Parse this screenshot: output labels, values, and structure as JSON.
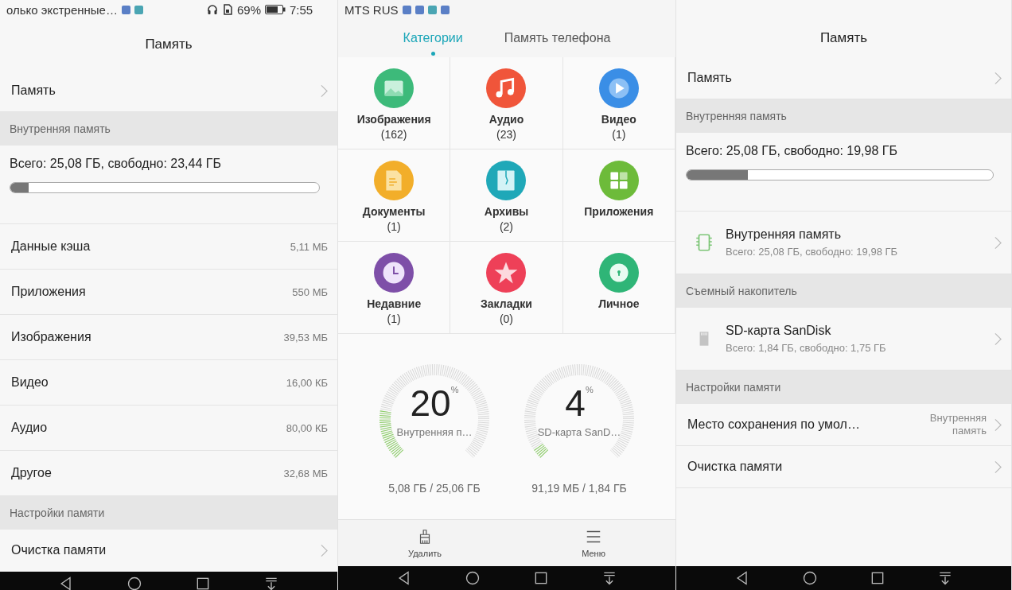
{
  "left": {
    "status_bar": {
      "notice": "олько экстренные…",
      "battery": "69%",
      "time": "7:55"
    },
    "title": "Память",
    "items": [
      {
        "kind": "link",
        "label": "Память"
      },
      {
        "kind": "header",
        "label": "Внутренняя память"
      },
      {
        "kind": "usage",
        "label": "Всего: 25,08 ГБ, свободно: 23,44 ГБ",
        "level": 0.06
      },
      {
        "kind": "value",
        "label": "Данные кэша",
        "value": "5,11 МБ"
      },
      {
        "kind": "value",
        "label": "Приложения",
        "value": "550 МБ"
      },
      {
        "kind": "value",
        "label": "Изображения",
        "value": "39,53 МБ"
      },
      {
        "kind": "value",
        "label": "Видео",
        "value": "16,00 КБ"
      },
      {
        "kind": "value",
        "label": "Аудио",
        "value": "80,00 КБ"
      },
      {
        "kind": "value",
        "label": "Другое",
        "value": "32,68 МБ"
      },
      {
        "kind": "header",
        "label": "Настройки памяти"
      },
      {
        "kind": "link",
        "label": "Очистка памяти"
      }
    ]
  },
  "middle": {
    "status_bar": {
      "carrier": "MTS RUS"
    },
    "tabs": [
      {
        "label": "Категории",
        "selected": true
      },
      {
        "label": "Память телефона",
        "selected": false
      }
    ],
    "categories": [
      {
        "label": "Изображения",
        "count": "(162)",
        "color": "#3dba7a"
      },
      {
        "label": "Аудио",
        "count": "(23)",
        "color": "#f0553a"
      },
      {
        "label": "Видео",
        "count": "(1)",
        "color": "#3a8ee6"
      },
      {
        "label": "Документы",
        "count": "(1)",
        "color": "#f2ae2a"
      },
      {
        "label": "Архивы",
        "count": "(2)",
        "color": "#1fa8b8"
      },
      {
        "label": "Приложения",
        "color": "#6dbb3a"
      },
      {
        "label": "Недавние",
        "count": "(1)",
        "color": "#7e4fa8"
      },
      {
        "label": "Закладки",
        "count": "(0)",
        "color": "#ee4058"
      },
      {
        "label": "Личное",
        "color": "#2fb577"
      }
    ],
    "gauges": [
      {
        "percent": "20",
        "unit": "%",
        "name": "Внутренняя п…",
        "usage": "5,08 ГБ / 25,06 ГБ"
      },
      {
        "percent": "4",
        "unit": "%",
        "name": "SD-карта SanD…",
        "usage": "91,19 МБ / 1,84 ГБ"
      }
    ],
    "toolbar": [
      {
        "label": "Удалить"
      },
      {
        "label": "Меню"
      }
    ]
  },
  "right": {
    "title": "Память",
    "items": [
      {
        "kind": "link",
        "label": "Память"
      },
      {
        "kind": "header",
        "label": "Внутренняя память"
      },
      {
        "kind": "usage",
        "label": "Всего: 25,08 ГБ, свободно: 19,98 ГБ",
        "level": 0.2
      },
      {
        "kind": "internal_storage",
        "label": "Внутренняя память",
        "detail": "Всего: 25,08 ГБ, свободно: 19,98 ГБ"
      },
      {
        "kind": "header",
        "label": "Съемный накопитель"
      },
      {
        "kind": "sd_card",
        "label": "SD-карта SanDisk",
        "detail": "Всего: 1,84 ГБ, свободно: 1,75 ГБ"
      },
      {
        "kind": "header",
        "label": "Настройки памяти"
      },
      {
        "kind": "choice",
        "label": "Место сохранения по умол…",
        "value": "Внутренняя память"
      },
      {
        "kind": "link",
        "label": "Очистка памяти"
      }
    ]
  }
}
